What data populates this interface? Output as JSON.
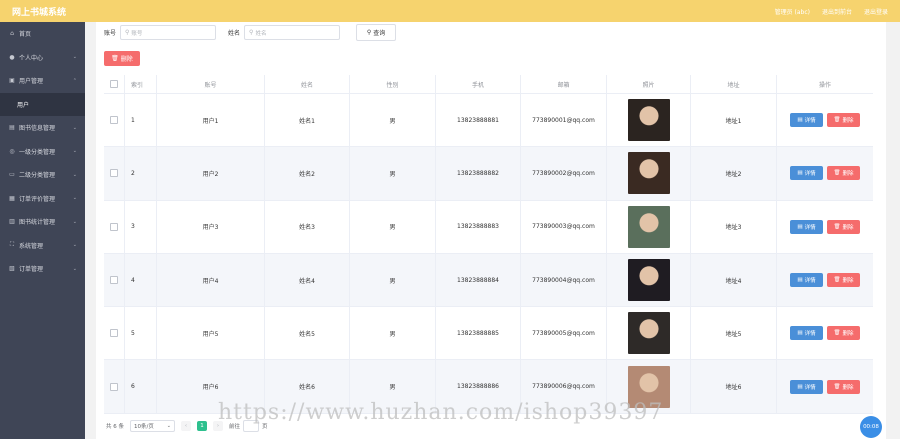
{
  "header": {
    "title": "网上书城系统",
    "right_items": [
      "管理员 (abc)",
      "退出到前台",
      "退出登录"
    ]
  },
  "sidebar": {
    "items": [
      {
        "label": "首页",
        "icon": "home-icon",
        "chevron": false
      },
      {
        "label": "个人中心",
        "icon": "user-icon",
        "chevron": true
      },
      {
        "label": "用户管理",
        "icon": "users-icon",
        "chevron": true
      },
      {
        "label": "用户",
        "icon": "",
        "chevron": false,
        "sub": true
      },
      {
        "label": "图书信息管理",
        "icon": "book-icon",
        "chevron": true
      },
      {
        "label": "一级分类管理",
        "icon": "category-icon",
        "chevron": true
      },
      {
        "label": "二级分类管理",
        "icon": "subcategory-icon",
        "chevron": true
      },
      {
        "label": "订单评价管理",
        "icon": "review-icon",
        "chevron": true
      },
      {
        "label": "图书统计管理",
        "icon": "stats-icon",
        "chevron": true
      },
      {
        "label": "系统管理",
        "icon": "system-icon",
        "chevron": true
      },
      {
        "label": "订单管理",
        "icon": "order-icon",
        "chevron": true
      }
    ]
  },
  "search": {
    "account_label": "账号",
    "account_placeholder": "账号",
    "name_label": "姓名",
    "name_placeholder": "姓名",
    "query_label": "查询"
  },
  "toolbar": {
    "delete_label": "删除"
  },
  "table": {
    "columns": [
      "索引",
      "账号",
      "姓名",
      "性别",
      "手机",
      "邮箱",
      "照片",
      "地址",
      "操作"
    ],
    "rows": [
      {
        "index": "1",
        "account": "用户1",
        "name": "姓名1",
        "gender": "男",
        "phone": "13823888881",
        "email": "773890001@qq.com",
        "address": "地址1",
        "photo": "#2b2420"
      },
      {
        "index": "2",
        "account": "用户2",
        "name": "姓名2",
        "gender": "男",
        "phone": "13823888882",
        "email": "773890002@qq.com",
        "address": "地址2",
        "photo": "#3a2a22"
      },
      {
        "index": "3",
        "account": "用户3",
        "name": "姓名3",
        "gender": "男",
        "phone": "13823888883",
        "email": "773890003@qq.com",
        "address": "地址3",
        "photo": "#5a6f5c"
      },
      {
        "index": "4",
        "account": "用户4",
        "name": "姓名4",
        "gender": "男",
        "phone": "13823888884",
        "email": "773890004@qq.com",
        "address": "地址4",
        "photo": "#1f1c22"
      },
      {
        "index": "5",
        "account": "用户5",
        "name": "姓名5",
        "gender": "男",
        "phone": "13823888885",
        "email": "773890005@qq.com",
        "address": "地址5",
        "photo": "#2e2a28"
      },
      {
        "index": "6",
        "account": "用户6",
        "name": "姓名6",
        "gender": "男",
        "phone": "13823888886",
        "email": "773890006@qq.com",
        "address": "地址6",
        "photo": "#b48a74"
      }
    ],
    "detail_label": "详情",
    "delete_label": "删除"
  },
  "pagination": {
    "total_text": "共 6 条",
    "page_size": "10条/页",
    "current_page": "1",
    "goto_label": "前往",
    "page_unit": "页"
  },
  "watermark": "https://www.huzhan.com/ishop39397",
  "float_badge": "00:08",
  "colors": {
    "header": "#f6d36e",
    "sidebar": "#3f4556",
    "danger": "#f56c6c",
    "primary": "#4a8fd8",
    "page_active": "#2ec08e"
  }
}
